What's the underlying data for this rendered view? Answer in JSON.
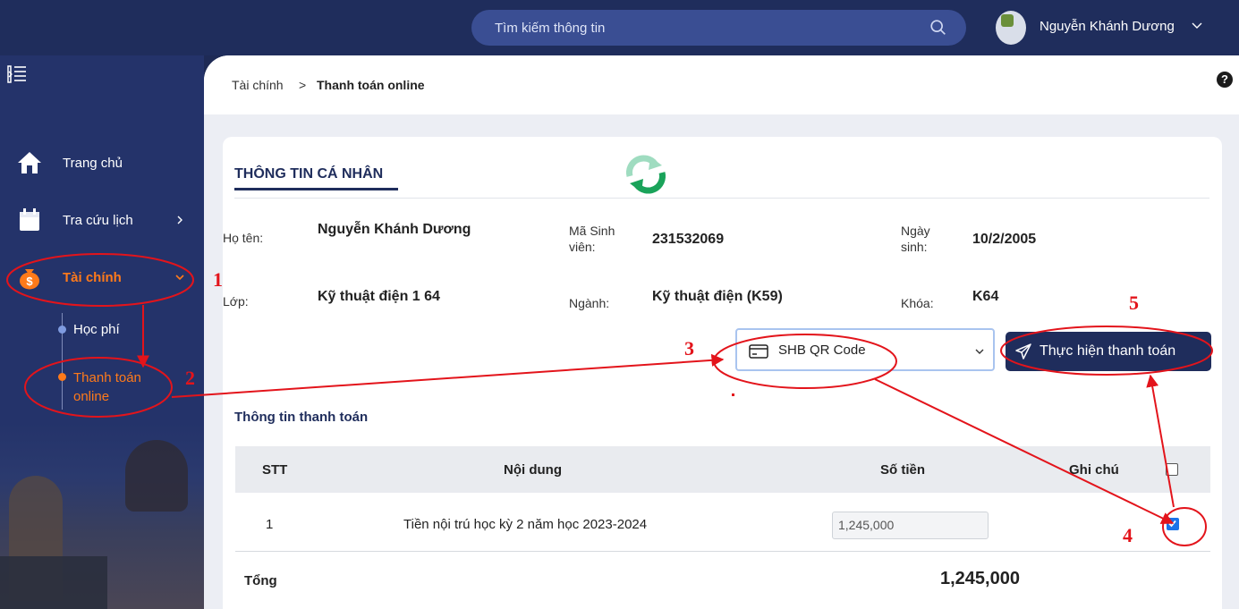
{
  "header": {
    "search_placeholder": "Tìm kiếm thông tin",
    "username": "Nguyễn Khánh Dương"
  },
  "sidebar": {
    "items": [
      {
        "label": "Trang chủ",
        "icon": "home-icon"
      },
      {
        "label": "Tra cứu lịch",
        "icon": "calendar-icon"
      },
      {
        "label": "Tài chính",
        "icon": "money-bag-icon"
      }
    ],
    "subitems": [
      {
        "label": "Học phí"
      },
      {
        "label_line1": "Thanh toán",
        "label_line2": "online"
      }
    ]
  },
  "breadcrumb": {
    "parent": "Tài chính",
    "separator": ">",
    "current": "Thanh toán online"
  },
  "help_glyph": "?",
  "personal": {
    "title": "THÔNG TIN CÁ NHÂN",
    "name_label": "Họ tên:",
    "name": "Nguyễn Khánh Dương",
    "id_label_1": "Mã Sinh",
    "id_label_2": "viên:",
    "id": "231532069",
    "dob_label_1": "Ngày",
    "dob_label_2": "sinh:",
    "dob": "10/2/2005",
    "class_label": "Lớp:",
    "class": "Kỹ thuật điện 1 64",
    "major_label": "Ngành:",
    "major": "Kỹ thuật điện (K59)",
    "cohort_label": "Khóa:",
    "cohort": "K64"
  },
  "payment": {
    "method": "SHB QR Code",
    "submit_label": "Thực hiện thanh toán",
    "section_title": "Thông tin thanh toán",
    "columns": {
      "stt": "STT",
      "content": "Nội dung",
      "amount": "Số tiền",
      "note": "Ghi chú"
    },
    "rows": [
      {
        "stt": "1",
        "content": "Tiền nội trú học kỳ 2 năm học 2023-2024",
        "amount": "1,245,000",
        "checked": true
      }
    ],
    "total_label": "Tổng",
    "total": "1,245,000"
  },
  "annotations": {
    "numbers": [
      "1",
      "2",
      "3",
      "4",
      "5"
    ],
    "color": "#e3141b"
  },
  "colors": {
    "navy": "#1f2d5c",
    "active_orange": "#ff7a1a",
    "refresh_green": "#1aa35a",
    "checkbox_blue": "#1a73e8"
  }
}
